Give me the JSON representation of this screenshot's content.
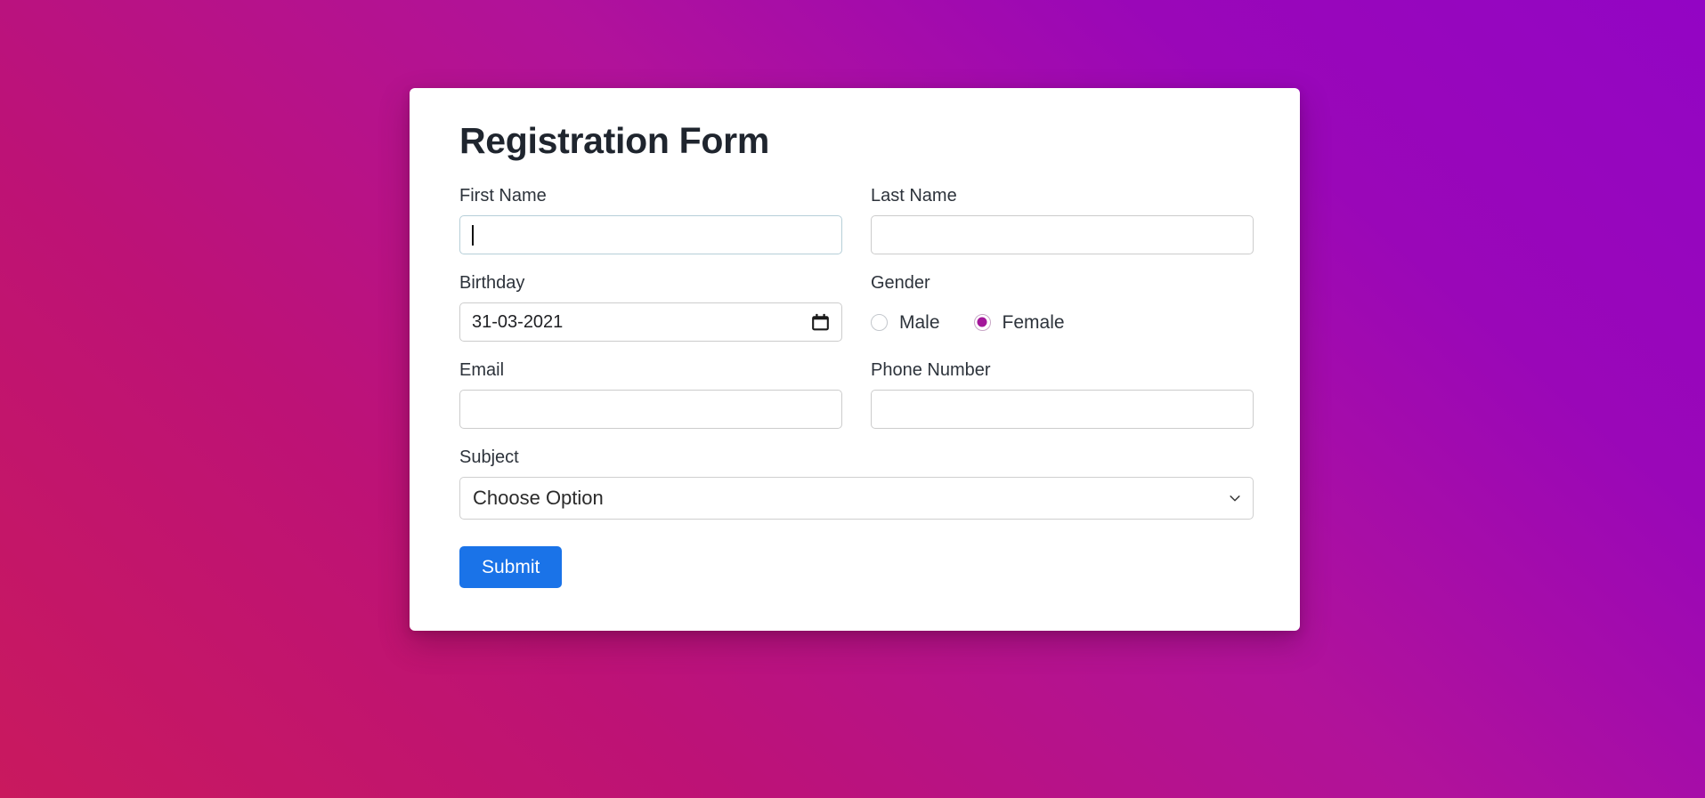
{
  "page": {
    "background_gradient_from": "#c9195e",
    "background_gradient_to": "#9305c4"
  },
  "form": {
    "title": "Registration Form",
    "fields": {
      "first_name": {
        "label": "First Name",
        "value": "",
        "placeholder": "",
        "focused": true
      },
      "last_name": {
        "label": "Last Name",
        "value": "",
        "placeholder": ""
      },
      "birthday": {
        "label": "Birthday",
        "value": "31-03-2021",
        "icon": "calendar-icon"
      },
      "gender": {
        "label": "Gender",
        "options": [
          {
            "label": "Male",
            "selected": false
          },
          {
            "label": "Female",
            "selected": true
          }
        ],
        "accent_color": "#a3179a"
      },
      "email": {
        "label": "Email",
        "value": "",
        "placeholder": ""
      },
      "phone_number": {
        "label": "Phone Number",
        "value": "",
        "placeholder": ""
      },
      "subject": {
        "label": "Subject",
        "selected": "Choose Option",
        "icon": "chevron-down-icon"
      }
    },
    "submit": {
      "label": "Submit",
      "color": "#1a73e8"
    }
  }
}
